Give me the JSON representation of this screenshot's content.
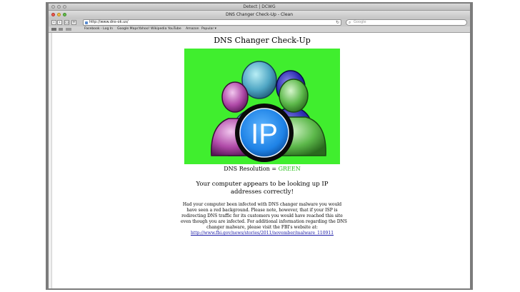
{
  "window": {
    "outer_title": "Detect | DCWG",
    "title": "DNS Changer Check-Up - Clean"
  },
  "toolbar": {
    "back_icon": "back-arrow-icon",
    "forward_icon": "forward-arrow-icon",
    "add_icon": "plus-icon",
    "url": "http://www.dns-ok.us/",
    "search_placeholder": "Google"
  },
  "bookmarks": [
    "Facebook - Log In",
    "Google Maps",
    "Yahoo!",
    "Wikipedia",
    "YouTube",
    "Amazon",
    "Popular ▾"
  ],
  "page": {
    "heading": "DNS Changer Check-Up",
    "hero_label": "IP",
    "hero_background": "#40ee2e",
    "resolution_label": "DNS Resolution = ",
    "resolution_value": "GREEN",
    "message": "Your computer appears to be looking up IP addresses correctly!",
    "paragraph_lines": [
      "Had your computer been infected with DNS changer malware you would",
      "have seen a red background.  Please note, however, that if your ISP is",
      "redirecting DNS traffic for its customers you would have reached this site",
      "even though you are infected. For additional information regarding the DNS",
      "changer malware, please visit the FBI's website at:"
    ],
    "link": "http://www.fbi.gov/news/stories/2011/november/malware_110911"
  }
}
